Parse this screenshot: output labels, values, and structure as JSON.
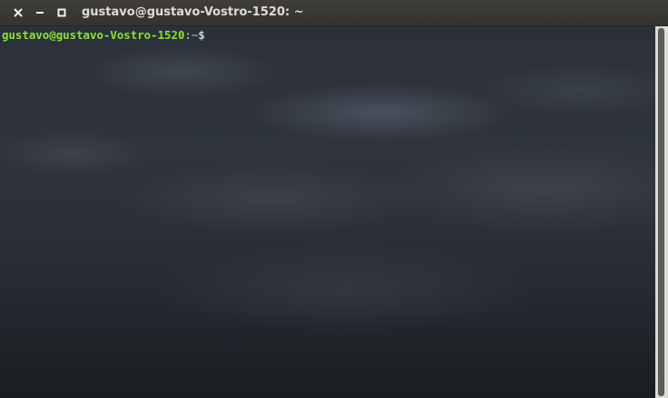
{
  "window": {
    "title": "gustavo@gustavo-Vostro-1520: ~"
  },
  "titlebar_buttons": {
    "close_icon": "close-icon",
    "minimize_icon": "minimize-icon",
    "maximize_icon": "maximize-icon"
  },
  "terminal": {
    "prompt": {
      "user": "gustavo",
      "at": "@",
      "host": "gustavo-Vostro-1520",
      "colon": ":",
      "path": "~",
      "symbol": "$"
    }
  },
  "colors": {
    "user_host": "#8ae234",
    "path": "#729fcf",
    "text": "#d3d7cf",
    "titlebar": "#3c3b37",
    "title_text": "#dfdbd2",
    "scrollbar_track": "#dcdad5",
    "scrollbar_thumb": "#5e5c56"
  }
}
